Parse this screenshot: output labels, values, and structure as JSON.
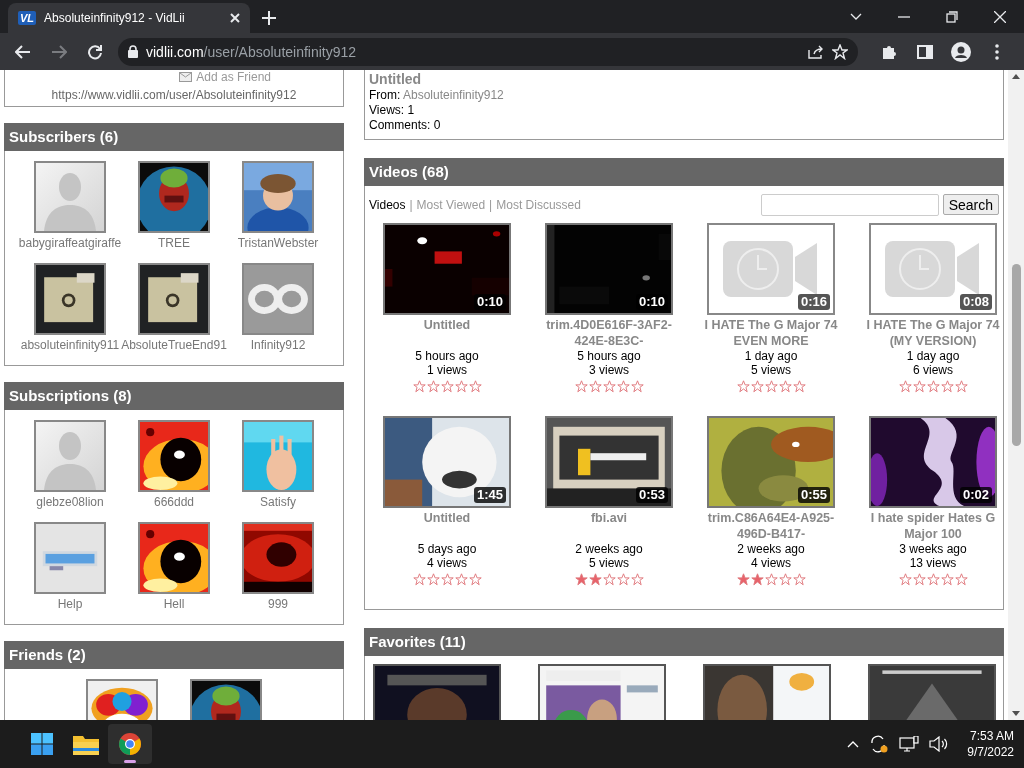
{
  "browser": {
    "favicon": "VL",
    "tab_title": "Absoluteinfinity912 - VidLii",
    "url_host": "vidlii.com",
    "url_path": "/user/Absoluteinfinity912"
  },
  "profile_card": {
    "add_friend": "Add as Friend",
    "channel_url": "https://www.vidlii.com/user/Absoluteinfinity912"
  },
  "subscribers": {
    "title": "Subscribers (6)",
    "users": [
      {
        "name": "babygiraffeatgiraffe",
        "kind": "default"
      },
      {
        "name": "TREE",
        "kind": "picture"
      },
      {
        "name": "TristanWebster",
        "kind": "picture"
      },
      {
        "name": "absoluteinfinity911",
        "kind": "picture"
      },
      {
        "name": "AbsoluteTrueEnd91",
        "kind": "picture"
      },
      {
        "name": "Infinity912",
        "kind": "picture"
      }
    ]
  },
  "subscriptions": {
    "title": "Subscriptions (8)",
    "users": [
      {
        "name": "glebze08lion",
        "kind": "default"
      },
      {
        "name": "666ddd",
        "kind": "picture"
      },
      {
        "name": "Satisfy",
        "kind": "picture"
      },
      {
        "name": "Help",
        "kind": "picture"
      },
      {
        "name": "Hell",
        "kind": "picture"
      },
      {
        "name": "999",
        "kind": "picture"
      }
    ]
  },
  "friends": {
    "title": "Friends (2)"
  },
  "featured_video": {
    "title": "Untitled",
    "from_label": "From:",
    "from_user": "Absoluteinfinity912",
    "views": "Views: 1",
    "comments": "Comments: 0"
  },
  "videos": {
    "title": "Videos (68)",
    "tabs": [
      {
        "label": "Videos",
        "selected": true
      },
      {
        "label": "Most Viewed",
        "selected": false
      },
      {
        "label": "Most Discussed",
        "selected": false
      }
    ],
    "separators": [
      "|",
      "|"
    ],
    "search_button": "Search",
    "items": [
      {
        "kind": "picture",
        "duration": "0:10",
        "title": "Untitled",
        "age": "5 hours ago",
        "views": "1 views",
        "stars": 0
      },
      {
        "kind": "picture",
        "duration": "0:10",
        "title": "trim.4D0E616F-3AF2-424E-8E3C-",
        "age": "5 hours ago",
        "views": "3 views",
        "stars": 0
      },
      {
        "kind": "placeholder",
        "duration": "0:16",
        "title": "I HATE The G Major 74 EVEN MORE",
        "age": "1 day ago",
        "views": "5 views",
        "stars": 0
      },
      {
        "kind": "placeholder",
        "duration": "0:08",
        "title": "I HATE The G Major 74 (MY VERSION)",
        "age": "1 day ago",
        "views": "6 views",
        "stars": 0
      },
      {
        "kind": "picture",
        "duration": "1:45",
        "title": "Untitled",
        "age": "5 days ago",
        "views": "4 views",
        "stars": 0
      },
      {
        "kind": "picture",
        "duration": "0:53",
        "title": "fbi.avi",
        "age": "2 weeks ago",
        "views": "5 views",
        "stars": 2
      },
      {
        "kind": "picture",
        "duration": "0:55",
        "title": "trim.C86A64E4-A925-496D-B417-",
        "age": "2 weeks ago",
        "views": "4 views",
        "stars": 2
      },
      {
        "kind": "picture",
        "duration": "0:02",
        "title": "I hate spider Hates G Major 100",
        "age": "3 weeks ago",
        "views": "13 views",
        "stars": 0
      }
    ]
  },
  "favorites": {
    "title": "Favorites (11)"
  },
  "taskbar": {
    "time": "7:53 AM",
    "date": "9/7/2022"
  }
}
